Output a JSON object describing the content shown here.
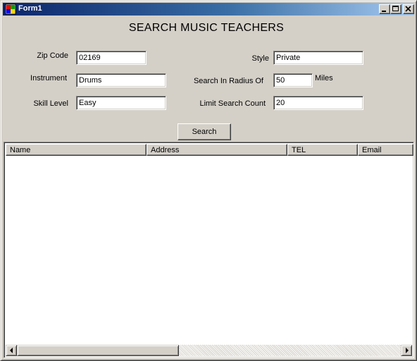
{
  "window": {
    "title": "Form1",
    "icon": "app-icon",
    "controls": [
      "minimize-icon",
      "maximize-icon",
      "close-icon"
    ]
  },
  "form": {
    "heading": "SEARCH MUSIC TEACHERS",
    "fields": {
      "zip": {
        "label": "Zip Code",
        "value": "02169"
      },
      "instrument": {
        "label": "Instrument",
        "value": "Drums"
      },
      "skill": {
        "label": "Skill Level",
        "value": "Easy"
      },
      "style": {
        "label": "Style",
        "value": "Private"
      },
      "radius": {
        "label": "Search In Radius Of",
        "value": "50",
        "unit": "Miles"
      },
      "limit": {
        "label": "Limit Search Count",
        "value": "20"
      }
    },
    "search_button": "Search"
  },
  "results": {
    "columns": [
      "Name",
      "Address",
      "TEL",
      "Email"
    ],
    "rows": []
  },
  "colors": {
    "title_bar_start": "#0a246a",
    "title_bar_end": "#a6caf0",
    "face": "#d4d0c8"
  }
}
